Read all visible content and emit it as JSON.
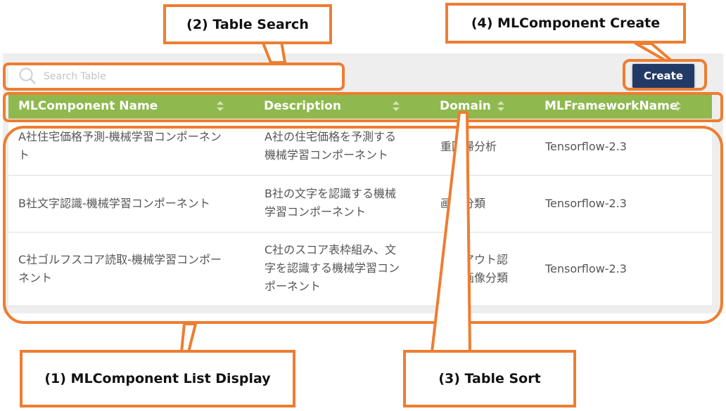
{
  "search": {
    "placeholder": "Search Table"
  },
  "toolbar": {
    "create_label": "Create"
  },
  "table": {
    "columns": [
      "MLComponent Name",
      "Description",
      "Domain",
      "MLFrameworkName"
    ],
    "rows": [
      {
        "name": [
          "A社住宅価格予測-機械学習コンポーネン",
          "ト"
        ],
        "description": [
          "A社の住宅価格を予測する",
          "機械学習コンポーネント"
        ],
        "domain": [
          "重回帰分析"
        ],
        "framework": "Tensorflow-2.3"
      },
      {
        "name": [
          "B社文字認識-機械学習コンポーネント"
        ],
        "description": [
          "B社の文字を認識する機械",
          "学習コンポーネント"
        ],
        "domain": [
          "画像分類"
        ],
        "framework": "Tensorflow-2.3"
      },
      {
        "name": [
          "C社ゴルフスコア読取-機械学習コンポー",
          "ネント"
        ],
        "description": [
          "C社のスコア表枠組み、文",
          "字を認識する機械学習コン",
          "ポーネント"
        ],
        "domain": [
          "レイアウト認",
          "識、画像分類"
        ],
        "framework": "Tensorflow-2.3"
      }
    ]
  },
  "annotations": {
    "list_display": "(1) MLComponent List Display",
    "table_search": "(2) Table Search",
    "table_sort": "(3) Table Sort",
    "component_create": "(4) MLComponent Create"
  },
  "colors": {
    "header_green": "#8fb84e",
    "button_navy": "#243a66",
    "annotation_orange": "#ee7d31"
  },
  "icons": {
    "search": "search-icon",
    "sort": "sort-icon"
  }
}
